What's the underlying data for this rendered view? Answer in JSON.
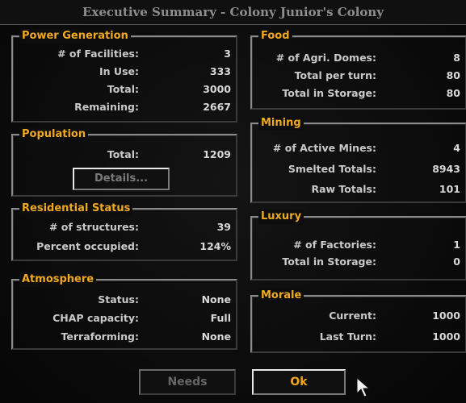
{
  "window": {
    "title": "Executive Summary - Colony Junior's Colony"
  },
  "power": {
    "title": "Power Generation",
    "rows": [
      {
        "label": "# of Facilities:",
        "value": "3"
      },
      {
        "label": "In Use:",
        "value": "333"
      },
      {
        "label": "Total:",
        "value": "3000"
      },
      {
        "label": "Remaining:",
        "value": "2667"
      }
    ]
  },
  "population": {
    "title": "Population",
    "total_label": "Total:",
    "total_value": "1209",
    "details_label": "Details..."
  },
  "residential": {
    "title": "Residential Status",
    "rows": [
      {
        "label": "# of structures:",
        "value": "39"
      },
      {
        "label": "Percent occupied:",
        "value": "124%"
      }
    ]
  },
  "atmosphere": {
    "title": "Atmosphere",
    "rows": [
      {
        "label": "Status:",
        "value": "None"
      },
      {
        "label": "CHAP capacity:",
        "value": "Full"
      },
      {
        "label": "Terraforming:",
        "value": "None"
      }
    ]
  },
  "food": {
    "title": "Food",
    "rows": [
      {
        "label": "# of Agri. Domes:",
        "value": "8"
      },
      {
        "label": "Total per turn:",
        "value": "80"
      },
      {
        "label": "Total in Storage:",
        "value": "80"
      }
    ]
  },
  "mining": {
    "title": "Mining",
    "rows": [
      {
        "label": "# of Active Mines:",
        "value": "4"
      },
      {
        "label": "Smelted Totals:",
        "value": "8943"
      },
      {
        "label": "Raw Totals:",
        "value": "101"
      }
    ]
  },
  "luxury": {
    "title": "Luxury",
    "rows": [
      {
        "label": "# of Factories:",
        "value": "1"
      },
      {
        "label": "Total in Storage:",
        "value": "0"
      }
    ]
  },
  "morale": {
    "title": "Morale",
    "rows": [
      {
        "label": "Current:",
        "value": "1000"
      },
      {
        "label": "Last Turn:",
        "value": "1000"
      }
    ]
  },
  "buttons": {
    "needs": "Needs",
    "ok": "Ok"
  },
  "colors": {
    "heading": "#f0a820",
    "text": "#c9c9c9",
    "border": "#8a8a8a"
  },
  "icons": {
    "cursor": "arrow-cursor-icon"
  }
}
